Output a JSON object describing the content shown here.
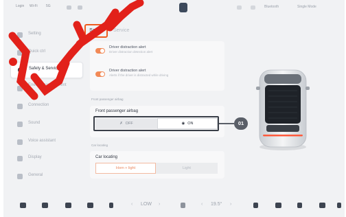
{
  "status_bar": {
    "left_items": [
      "Login",
      "Wi-Fi",
      "5G"
    ],
    "right_items": [
      "Bluetooth",
      "Single Mode"
    ]
  },
  "sidebar": {
    "items": [
      {
        "label": "Setting",
        "active": false
      },
      {
        "label": "Quick ctrl",
        "active": false
      },
      {
        "label": "Safety & Service",
        "active": true
      },
      {
        "label": "Energy management",
        "active": false
      },
      {
        "label": "Connection",
        "active": false
      },
      {
        "label": "Sound",
        "active": false
      },
      {
        "label": "Voice assistant",
        "active": false
      },
      {
        "label": "Display",
        "active": false
      },
      {
        "label": "General",
        "active": false
      }
    ]
  },
  "tabs": {
    "safety": "Safety",
    "service": "Service"
  },
  "alerts": [
    {
      "title": "Driver distraction alert",
      "desc": "Driver distraction detection alert",
      "enabled": true
    },
    {
      "title": "Driver distraction alert",
      "desc": "Alerts if the driver is distracted while driving",
      "enabled": true
    }
  ],
  "airbag": {
    "section_label": "Front passenger airbag",
    "card_title": "Front passenger airbag",
    "off_label": "OFF",
    "on_label": "ON",
    "selected": "ON",
    "callout": "01"
  },
  "car_locating": {
    "section_label": "Car locating",
    "card_title": "Car locating",
    "option_1": "Horn + light",
    "option_2": "Light",
    "selected": "Horn + light"
  },
  "bottom_bar": {
    "fan_level": "LOW",
    "temperature": "19.5°"
  },
  "colors": {
    "accent": "#ef5b1e",
    "watermark": "#e2211a"
  }
}
